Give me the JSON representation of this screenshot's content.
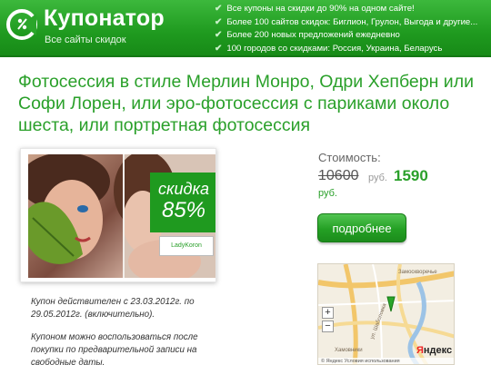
{
  "header": {
    "logo_title": "Купонатор",
    "logo_subtitle": "Все сайты скидок",
    "features": [
      "Все купоны на скидки до 90% на одном сайте!",
      "Более 100 сайтов скидок: Биглион, Грулон, Выгода и другие...",
      "Более 200 новых предложений ежедневно",
      "100 городов со скидками: Россия, Украина, Беларусь"
    ],
    "check_icon": "✔",
    "brand_color": "#1f9a1f"
  },
  "deal": {
    "title": "Фотосессия в стиле Мерлин Монро, Одри Хепберн или Софи Лорен, или эро-фотосессия с париками около шеста, или портретная фотосессия",
    "discount_label": "скидка",
    "discount_value": "85%",
    "partner_logo": "LadyKoron",
    "note_validity": "Купон действителен с 23.03.2012г. по 29.05.2012г. (включительно).",
    "note_usage": "Купоном можно воспользоваться после покупки по предварительной записи на свободные даты."
  },
  "price": {
    "label": "Стоимость:",
    "old_value": "10600",
    "currency": "руб.",
    "new_value": "1590",
    "currency_new": "руб.",
    "button_label": "подробнее"
  },
  "map": {
    "zoom_in": "+",
    "zoom_out": "−",
    "street_labels": [
      "Замоскворечье",
      "ул. Шаболовка",
      "Хамовники"
    ],
    "logo_red": "Я",
    "logo_rest": "ндекс",
    "footer": "© Яндекс Условия использования"
  }
}
